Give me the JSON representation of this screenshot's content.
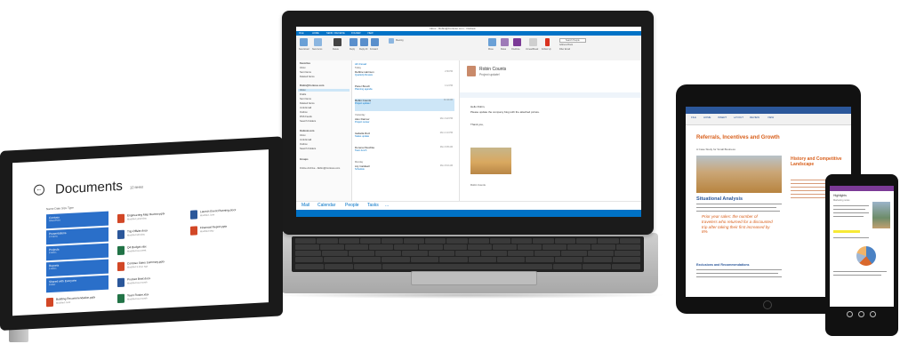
{
  "laptop": {
    "outlook": {
      "window_title": "Inbox - Robin@Contoso.com - Outlook",
      "tabs": [
        "FILE",
        "HOME",
        "SEND / RECEIVE",
        "FOLDER",
        "VIEW"
      ],
      "ribbon_labels": [
        "New Email",
        "New Items",
        "Delete",
        "Reply",
        "Reply All",
        "Forward",
        "Meeting",
        "Move",
        "Rules",
        "OneNote",
        "Unread/Read",
        "Follow Up",
        "Search People",
        "Address Book",
        "Filter Email"
      ],
      "folders": [
        "Favorites",
        "Inbox",
        "Sent Items",
        "Deleted Items",
        "Robin@Contoso.com",
        "Inbox",
        "Drafts",
        "Sent Items",
        "Deleted Items",
        "Junk Email",
        "Outbox",
        "RSS Feeds",
        "Search Folders",
        "Outlook.com",
        "Inbox",
        "Junk Email",
        "Outbox",
        "Search Folders",
        "Groups",
        "Online Archive - Robin@Contoso.com"
      ],
      "list_header": "All  Unread",
      "list_groups": [
        "Today",
        "Yesterday",
        "Monday"
      ],
      "messages": [
        {
          "from": "Debbie Harrison",
          "subject": "Quarterly Review",
          "time": "2:36 PM"
        },
        {
          "from": "Pieter Bosch",
          "subject": "Planning agenda",
          "time": "1:12 PM"
        },
        {
          "from": "Robin Counts",
          "subject": "Project update!",
          "time": "11:44 AM"
        },
        {
          "from": "Alex Darrow",
          "subject": "Project review",
          "time": "Mon 3:22 PM"
        },
        {
          "from": "Isabella Ruiz",
          "subject": "Status update",
          "time": "Mon 1:10 PM"
        },
        {
          "from": "Dorena Paschke",
          "subject": "Team lunch",
          "time": "Mon 9:05 AM"
        },
        {
          "from": "Lily Caldwell",
          "subject": "Schedule",
          "time": "Mon 8:16 AM"
        }
      ],
      "reading": {
        "sender": "Robin Counts",
        "subject": "Project update!",
        "greeting": "Hello Robin,",
        "body": "Please update the company blog with the attached picture.",
        "sign_off": "Thank you,",
        "footer": "Robin Counts"
      },
      "nav": [
        "Mail",
        "Calendar",
        "People",
        "Tasks",
        "..."
      ]
    }
  },
  "surface": {
    "title": "Documents",
    "count": "12 items",
    "tabs": "Name  Date  Size  Type",
    "tiles": [
      {
        "label": "Contoso",
        "meta": "SharePoint"
      },
      {
        "label": "Presentations",
        "meta": "12 items"
      },
      {
        "label": "Projects",
        "meta": "8 items"
      },
      {
        "label": "Reports",
        "meta": "5 items"
      },
      {
        "label": "Shared with Everyone",
        "meta": "Folder"
      }
    ],
    "files": [
      {
        "name": "Engineering Map Review.pptx",
        "meta": "Modified yesterday",
        "color": "#d24726"
      },
      {
        "name": "Trip Offsite.docx",
        "meta": "Modified Monday",
        "color": "#2b579a"
      },
      {
        "name": "Q4 Budget.xlsx",
        "meta": "Modified last week",
        "color": "#217346"
      },
      {
        "name": "Contoso Sales Summary.pptx",
        "meta": "Modified 3 days ago",
        "color": "#d24726"
      },
      {
        "name": "Product Brief.docx",
        "meta": "Modified last month",
        "color": "#2b579a"
      },
      {
        "name": "Team Roster.xlsx",
        "meta": "Modified last month",
        "color": "#217346"
      },
      {
        "name": "Building Recommendation.pptx",
        "meta": "Modified June",
        "color": "#d24726"
      },
      {
        "name": "Launch Event Planning.docx",
        "meta": "Modified June",
        "color": "#2b579a"
      },
      {
        "name": "Financial Report.pptx",
        "meta": "Modified May",
        "color": "#d24726"
      }
    ]
  },
  "ipad": {
    "app_tabs": [
      "FILE",
      "HOME",
      "INSERT",
      "LAYOUT",
      "REVIEW",
      "VIEW"
    ],
    "title": "Referrals, Incentives and Growth",
    "subtitle": "A Case Study for Small Business",
    "heading": "Situational Analysis",
    "quote": "Prior year sales: the number of travelers who returned for a discounted trip after taking their first increased by 8%",
    "sidebar": "History and Competitive Landscape",
    "section2": "Exclusions and Recommendations"
  },
  "phone": {
    "title": "Highlights",
    "subtitle": "Marketing notes"
  }
}
